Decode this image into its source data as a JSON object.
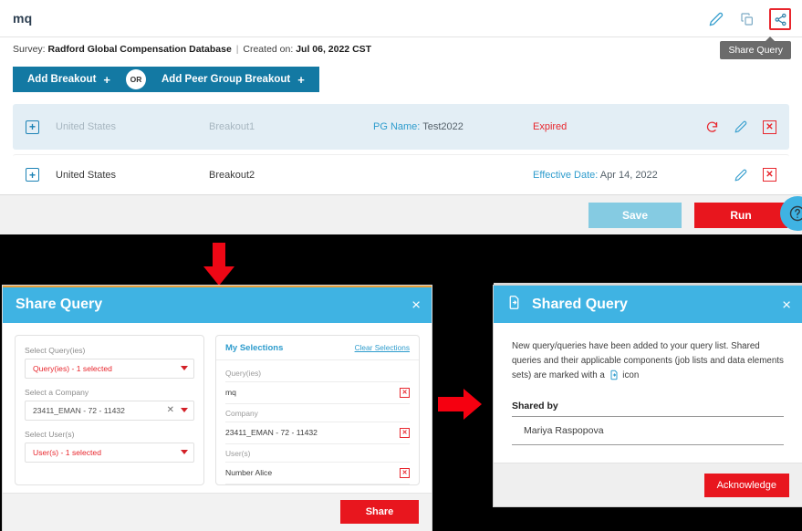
{
  "top_panel": {
    "query_title": "mq",
    "icons": [
      {
        "name": "edit-icon",
        "label": "Edit"
      },
      {
        "name": "copy-icon",
        "label": "Copy"
      },
      {
        "name": "share-icon",
        "label": "Share"
      }
    ],
    "tooltip": "Share Query",
    "survey": {
      "survey_label": "Survey:",
      "survey_name": "Radford Global Compensation Database",
      "separator": "|",
      "created_label": "Created on:",
      "created_value": "Jul 06, 2022 CST"
    },
    "buttons": {
      "add_breakout": "Add Breakout",
      "plus": "+",
      "or": "OR",
      "add_peer_group_breakout": "Add Peer Group Breakout"
    },
    "rows": [
      {
        "expand": "+",
        "country": "United States",
        "breakout": "Breakout1",
        "pg_label": "PG Name:",
        "pg_value": "Test2022",
        "status": "Expired",
        "status_type": "expired",
        "actions": [
          "refresh-icon",
          "edit-icon",
          "delete-icon"
        ]
      },
      {
        "expand": "+",
        "country": "United States",
        "breakout": "Breakout2",
        "pg_label": "",
        "pg_value": "",
        "date_label": "Effective Date:",
        "date_value": "Apr 14, 2022",
        "status_type": "effective",
        "actions": [
          "edit-icon",
          "delete-icon"
        ]
      }
    ],
    "footer": {
      "save": "Save",
      "run": "Run"
    }
  },
  "share_dialog": {
    "title": "Share Query",
    "close": "×",
    "fields": [
      {
        "label": "Select Query(ies)",
        "value": "Query(ies) - 1 selected",
        "style": "red",
        "clearable": false
      },
      {
        "label": "Select a Company",
        "value": "23411_EMAN - 72 - 11432",
        "style": "dark",
        "clearable": true
      },
      {
        "label": "Select User(s)",
        "value": "User(s) - 1 selected",
        "style": "red",
        "clearable": false
      }
    ],
    "selections": {
      "header": "My Selections",
      "clear": "Clear Selections",
      "groups": [
        {
          "group": "Query(ies)",
          "items": [
            "mq"
          ]
        },
        {
          "group": "Company",
          "items": [
            "23411_EMAN - 72 - 11432"
          ]
        },
        {
          "group": "User(s)",
          "items": [
            "Number Alice"
          ]
        }
      ]
    },
    "share_button": "Share"
  },
  "shared_dialog": {
    "title": "Shared Query",
    "close": "×",
    "body_part1": "New query/queries have been added to your query list. Shared queries and their applicable components (job lists and data elements sets) are marked with a",
    "body_part2": "icon",
    "shared_by_heading": "Shared by",
    "shared_by_value": "Mariya Raspopova",
    "acknowledge_button": "Acknowledge"
  },
  "colors": {
    "accent_blue": "#3fb3e3",
    "header_blue": "#1379a3",
    "red": "#e8161e",
    "link_blue": "#2e9ccd",
    "row_selected": "#e3eef5"
  }
}
